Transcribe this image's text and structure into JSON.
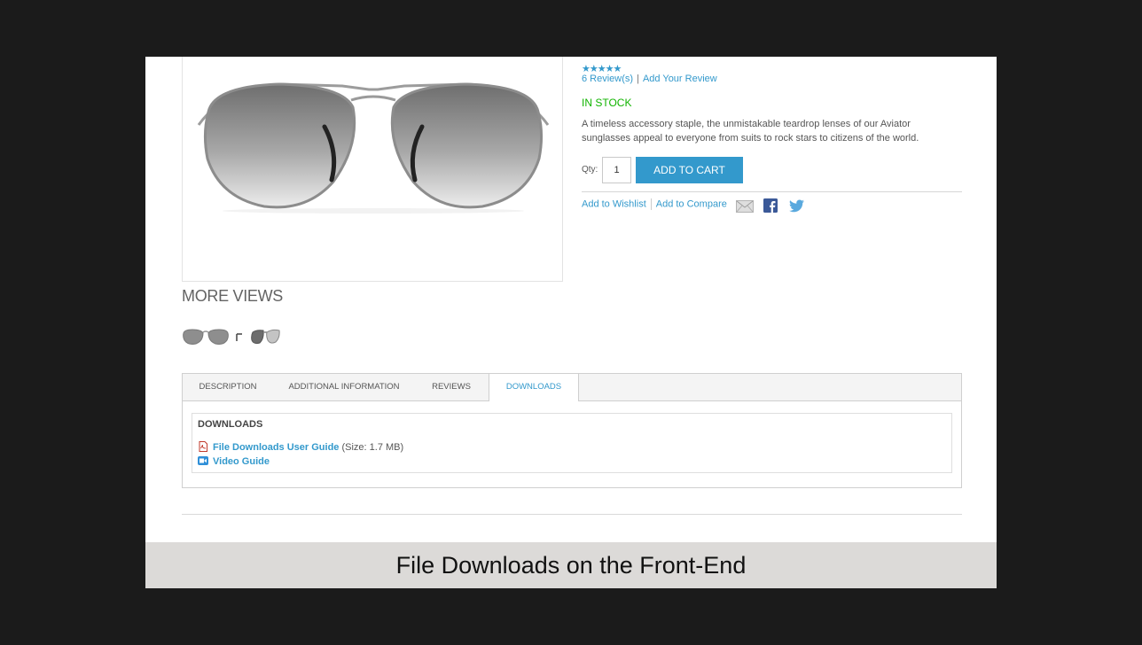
{
  "product": {
    "rating_stars": "★★★★",
    "rating_stars_empty": "★",
    "rating_fraction": 0.85,
    "reviews_link": "6 Review(s)",
    "review_separator": "|",
    "add_review_link": "Add Your Review",
    "stock_status": "IN STOCK",
    "description": "A timeless accessory staple, the unmistakable teardrop lenses of our Aviator sunglasses appeal to everyone from suits to rock stars to citizens of the world.",
    "qty_label": "Qty:",
    "qty_value": "1",
    "add_to_cart_label": "ADD TO CART",
    "wishlist_link": "Add to Wishlist",
    "compare_link": "Add to Compare"
  },
  "share_icons": [
    "email-icon",
    "facebook-icon",
    "twitter-icon"
  ],
  "more_views": {
    "title": "MORE VIEWS",
    "thumbnails": [
      "front-view-thumbnail",
      "side-view-thumbnail"
    ]
  },
  "tabs": [
    {
      "label": "DESCRIPTION",
      "active": false
    },
    {
      "label": "ADDITIONAL INFORMATION",
      "active": false
    },
    {
      "label": "REVIEWS",
      "active": false
    },
    {
      "label": "DOWNLOADS",
      "active": true
    }
  ],
  "downloads": {
    "title": "DOWNLOADS",
    "items": [
      {
        "label": "File Downloads User Guide",
        "meta": "(Size: 1.7 MB)",
        "icon": "pdf-icon"
      },
      {
        "label": "Video Guide",
        "meta": "",
        "icon": "video-icon"
      }
    ]
  },
  "caption": "File Downloads on the Front-End",
  "colors": {
    "accent": "#3399cc",
    "in_stock": "#11b400",
    "background": "#1b1b1b",
    "caption_bar": "#dcdad8"
  }
}
